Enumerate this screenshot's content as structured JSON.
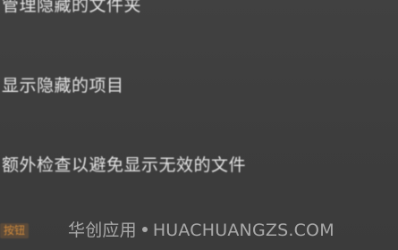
{
  "settings": {
    "hidden_folder_label": "管理隐藏的文件夹",
    "show_hidden_label": "显示隐藏的项目",
    "extra_check_label": "额外检查以避免显示无效的文件"
  },
  "footer": {
    "button_label": "按钮",
    "watermark_cn": "华创应用",
    "watermark_en": "HUACHUANGZS.COM"
  },
  "colors": {
    "background": "#3f3f3f",
    "text": "#e4e4e4",
    "accent": "#d08a3c"
  }
}
